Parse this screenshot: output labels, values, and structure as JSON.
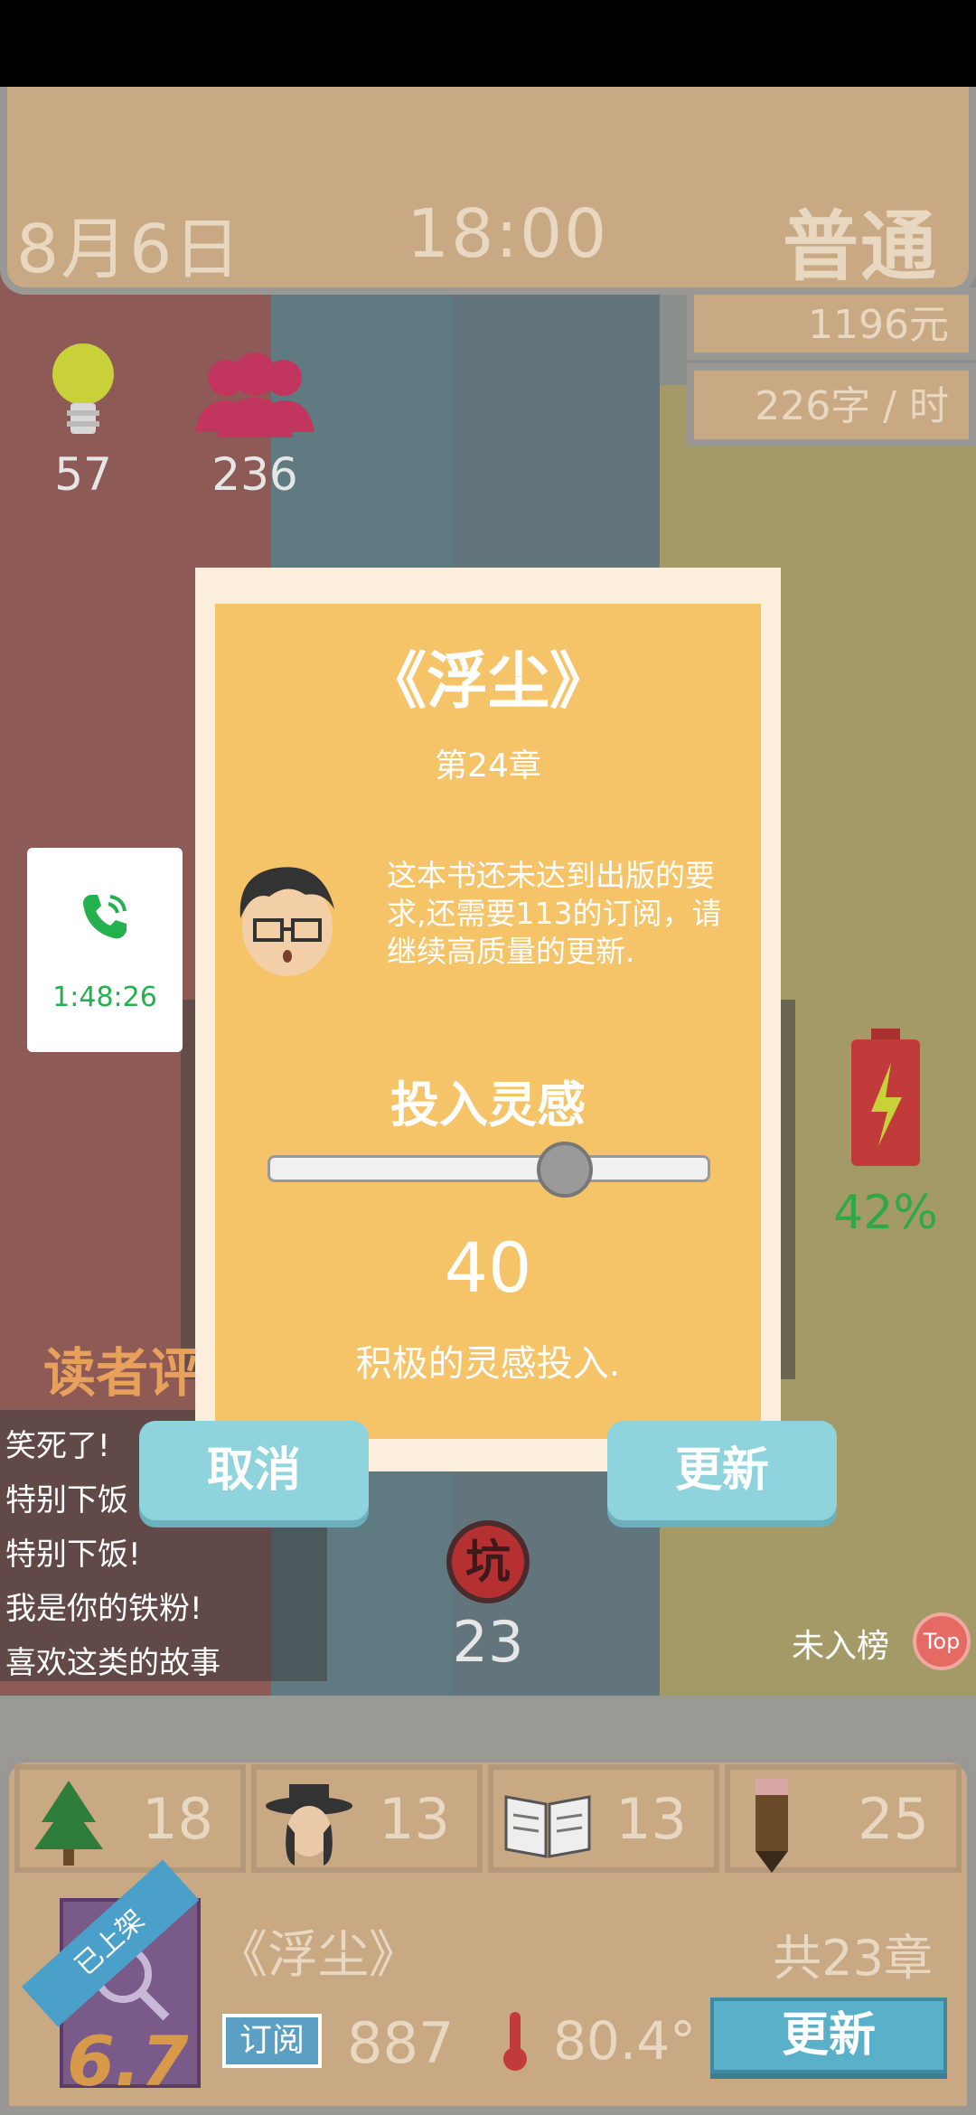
{
  "header": {
    "date": "8月6日",
    "time": "18:00",
    "difficulty": "普通",
    "money": "1196元",
    "speed": "226字 / 时"
  },
  "stats": {
    "inspiration": "57",
    "fans": "236"
  },
  "dialog": {
    "book_title": "《浮尘》",
    "chapter": "第24章",
    "message": "这本书还未达到出版的要求,还需要113的订阅，请继续高质量的更新.",
    "section_title": "投入灵感",
    "slider_value": "40",
    "slider_fraction": 0.7,
    "feedback": "积极的灵感投入.",
    "cancel_label": "取消",
    "update_label": "更新"
  },
  "call": {
    "duration": "1:48:26"
  },
  "battery": {
    "percent": "42%"
  },
  "reader_comments": {
    "title": "读者评",
    "items": [
      "笑死了!",
      "特别下饭",
      "特别下饭!",
      "我是你的铁粉!",
      "喜欢这类的故事"
    ]
  },
  "pit": {
    "label": "坑",
    "count": "23"
  },
  "ranking": {
    "status": "未入榜",
    "top_label": "Top"
  },
  "tabs": [
    {
      "icon": "tree-icon",
      "value": "18"
    },
    {
      "icon": "reader-hat-icon",
      "value": "13"
    },
    {
      "icon": "book-open-icon",
      "value": "13"
    },
    {
      "icon": "pencil-icon",
      "value": "25"
    }
  ],
  "book_card": {
    "ribbon": "已上架",
    "rating": "6.7",
    "title": "《浮尘》",
    "total_chapters": "共23章",
    "subscribe_label": "订阅",
    "subscriptions": "887",
    "temperature": "80.4°",
    "update_label": "更新"
  },
  "colors": {
    "panel": "#c9a983",
    "dialog": "#f5c469",
    "button": "#8fd3dc",
    "fans": "#c2355f",
    "bulb": "#c9d13a",
    "battery": "#c23b3b"
  }
}
